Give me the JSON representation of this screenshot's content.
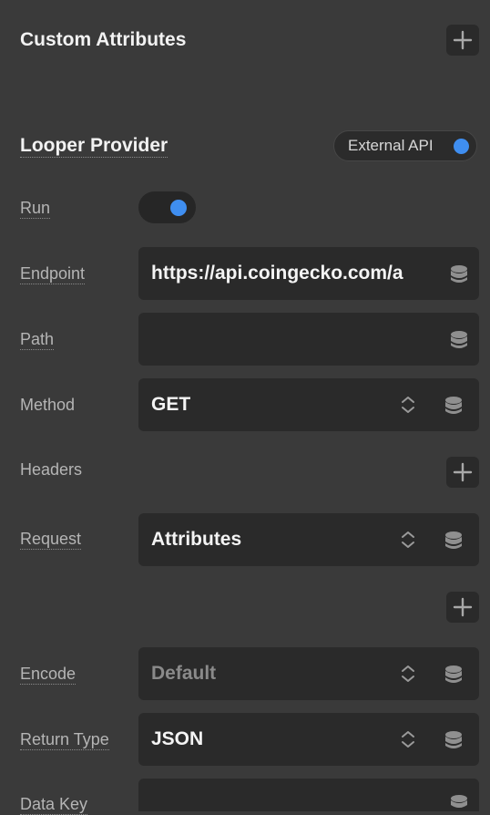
{
  "custom_attributes": {
    "title": "Custom Attributes"
  },
  "looper_provider": {
    "title": "Looper Provider",
    "source_pill": "External API"
  },
  "rows": {
    "run": {
      "label": "Run",
      "enabled": true
    },
    "endpoint": {
      "label": "Endpoint",
      "value": "https://api.coingecko.com/a"
    },
    "path": {
      "label": "Path",
      "value": ""
    },
    "method": {
      "label": "Method",
      "value": "GET"
    },
    "headers": {
      "label": "Headers"
    },
    "request": {
      "label": "Request",
      "value": "Attributes"
    },
    "encode": {
      "label": "Encode",
      "value": "Default"
    },
    "return_type": {
      "label": "Return Type",
      "value": "JSON"
    },
    "data_key": {
      "label": "Data Key",
      "value": ""
    }
  },
  "colors": {
    "background": "#3a3a3a",
    "field": "#2a2a2a",
    "accent": "#3f8ef0"
  },
  "icons": [
    "plus-icon",
    "database-icon",
    "chevron-updown-icon"
  ]
}
